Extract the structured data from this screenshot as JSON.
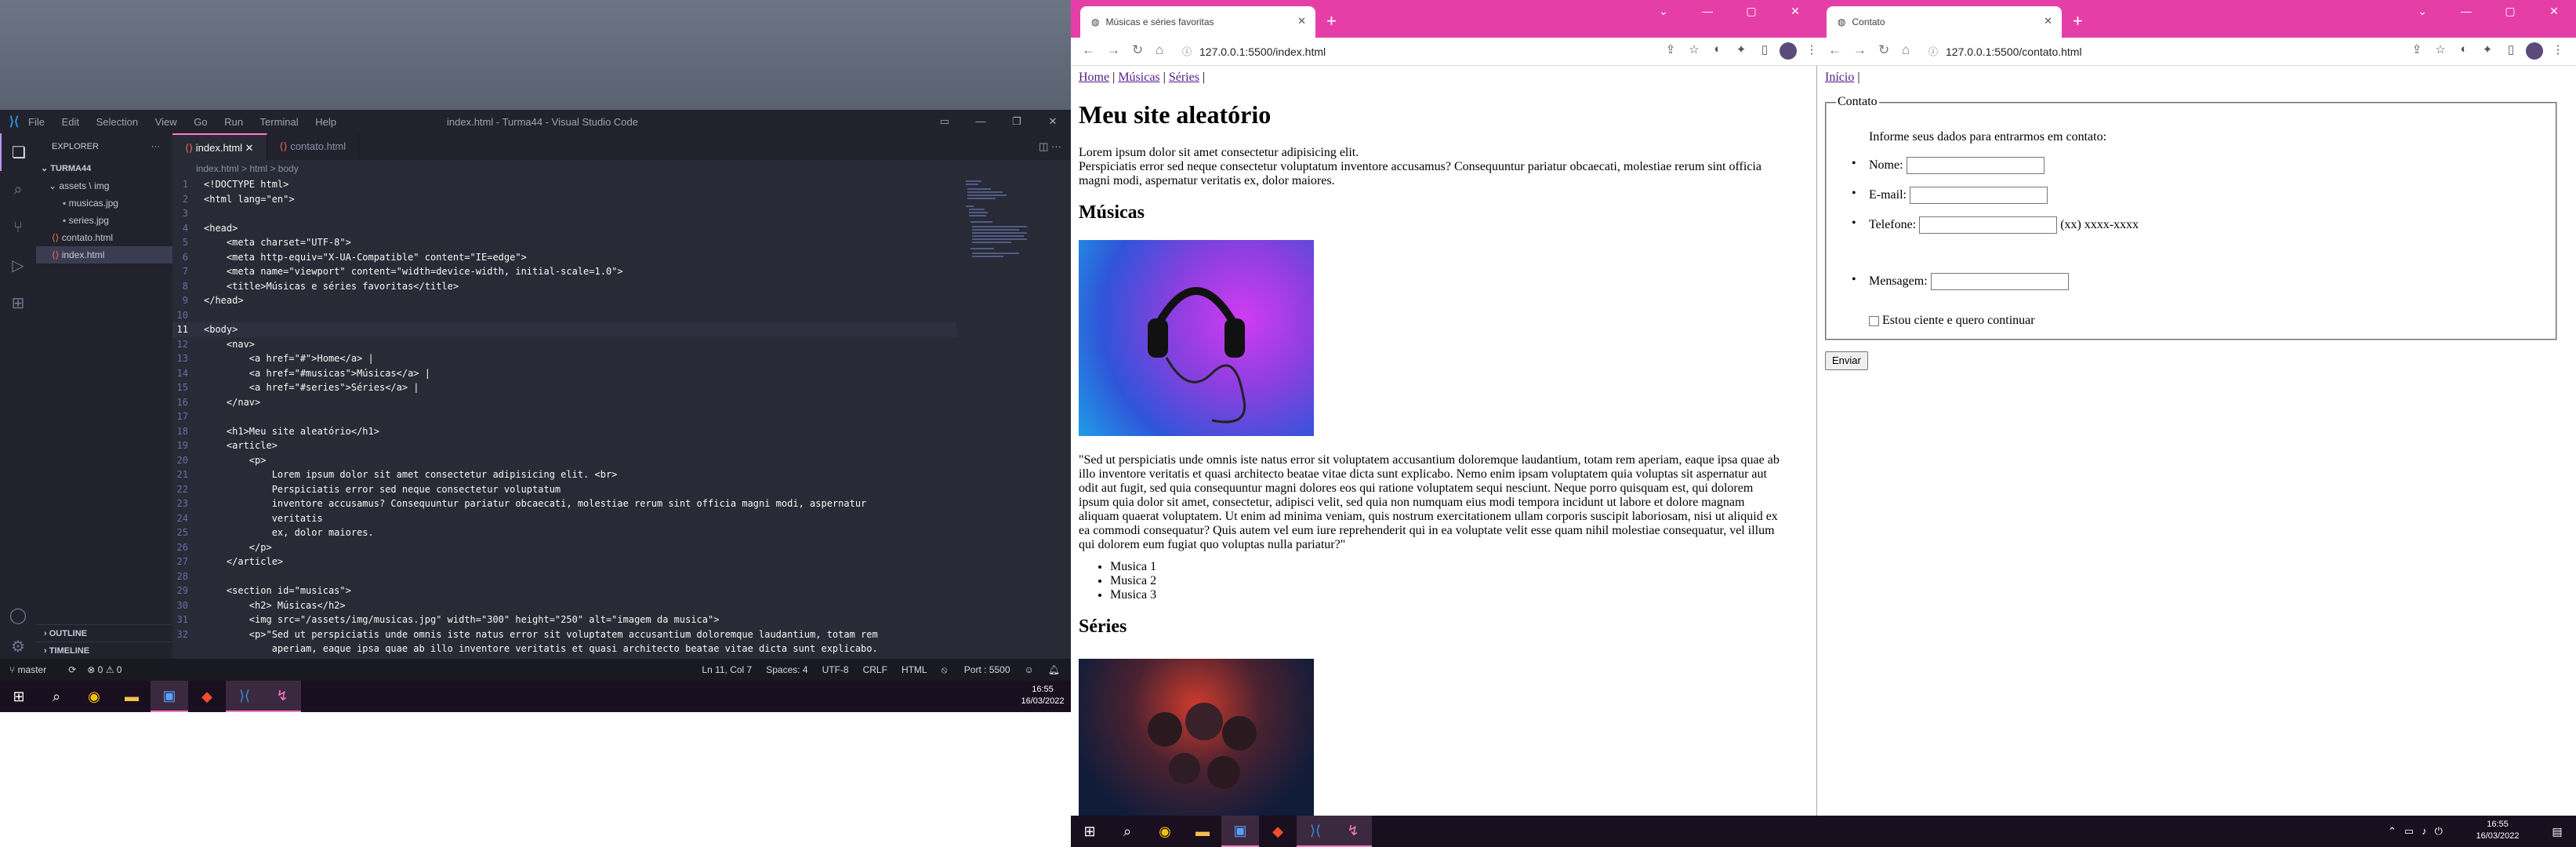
{
  "vscode": {
    "title": "index.html - Turma44 - Visual Studio Code",
    "menu": [
      "File",
      "Edit",
      "Selection",
      "View",
      "Go",
      "Run",
      "Terminal",
      "Help"
    ],
    "explorer_header": "EXPLORER",
    "folder": "TURMA44",
    "tree": [
      "assets \\ img",
      "musicas.jpg",
      "series.jpg",
      "contato.html",
      "index.html"
    ],
    "outline": "OUTLINE",
    "timeline": "TIMELINE",
    "tabs": [
      "index.html",
      "contato.html"
    ],
    "breadcrumb": "index.html > html > body",
    "code": [
      {
        "n": "1",
        "t": "<!DOCTYPE html>"
      },
      {
        "n": "2",
        "t": "<html lang=\"en\">"
      },
      {
        "n": "3",
        "t": ""
      },
      {
        "n": "4",
        "t": "<head>"
      },
      {
        "n": "5",
        "t": "    <meta charset=\"UTF-8\">"
      },
      {
        "n": "6",
        "t": "    <meta http-equiv=\"X-UA-Compatible\" content=\"IE=edge\">"
      },
      {
        "n": "7",
        "t": "    <meta name=\"viewport\" content=\"width=device-width, initial-scale=1.0\">"
      },
      {
        "n": "8",
        "t": "    <title>Músicas e séries favoritas</title>"
      },
      {
        "n": "9",
        "t": "</head>"
      },
      {
        "n": "10",
        "t": ""
      },
      {
        "n": "11",
        "t": "<body>"
      },
      {
        "n": "12",
        "t": "    <nav>"
      },
      {
        "n": "13",
        "t": "        <a href=\"#\">Home</a> |"
      },
      {
        "n": "14",
        "t": "        <a href=\"#musicas\">Músicas</a> |"
      },
      {
        "n": "15",
        "t": "        <a href=\"#series\">Séries</a> |"
      },
      {
        "n": "16",
        "t": "    </nav>"
      },
      {
        "n": "17",
        "t": ""
      },
      {
        "n": "18",
        "t": "    <h1>Meu site aleatório</h1>"
      },
      {
        "n": "19",
        "t": "    <article>"
      },
      {
        "n": "20",
        "t": "        <p>"
      },
      {
        "n": "21",
        "t": "            Lorem ipsum dolor sit amet consectetur adipisicing elit. <br>"
      },
      {
        "n": "22",
        "t": "            Perspiciatis error sed neque consectetur voluptatum"
      },
      {
        "n": "23",
        "t": "            inventore accusamus? Consequuntur pariatur obcaecati, molestiae rerum sint officia magni modi, aspernatur"
      },
      {
        "n": "24",
        "t": "            veritatis"
      },
      {
        "n": "25",
        "t": "            ex, dolor maiores."
      },
      {
        "n": "26",
        "t": "        </p>"
      },
      {
        "n": "27",
        "t": "    </article>"
      },
      {
        "n": "28",
        "t": ""
      },
      {
        "n": "29",
        "t": "    <section id=\"musicas\">"
      },
      {
        "n": "30",
        "t": "        <h2> Músicas</h2>"
      },
      {
        "n": "31",
        "t": "        <img src=\"/assets/img/musicas.jpg\" width=\"300\" height=\"250\" alt=\"imagem da musica\">"
      },
      {
        "n": "32",
        "t": "        <p>\"Sed ut perspiciatis unde omnis iste natus error sit voluptatem accusantium doloremque laudantium, totam rem"
      },
      {
        "n": "",
        "t": "            aperiam, eaque ipsa quae ab illo inventore veritatis et quasi architecto beatae vitae dicta sunt explicabo."
      }
    ],
    "status": {
      "branch": "master",
      "problems": "⊗ 0 ⚠ 0",
      "position": "Ln 11, Col 7",
      "spaces": "Spaces: 4",
      "encoding": "UTF-8",
      "eol": "CRLF",
      "language": "HTML",
      "port": "Port : 5500"
    }
  },
  "taskbar_left": {
    "time": "16:55",
    "date": "16/03/2022"
  },
  "taskbar_right": {
    "time": "16:55",
    "date": "16/03/2022"
  },
  "browser1": {
    "tab_title": "Músicas e séries favoritas",
    "url": "127.0.0.1:5500/index.html",
    "nav_links": [
      "Home",
      "Músicas",
      "Séries"
    ],
    "nav_sep": "|",
    "h1": "Meu site aleatório",
    "lorem_line1": "Lorem ipsum dolor sit amet consectetur adipisicing elit.",
    "lorem_line2": "Perspiciatis error sed neque consectetur voluptatum inventore accusamus? Consequuntur pariatur obcaecati, molestiae rerum sint officia magni modi, aspernatur veritatis ex, dolor maiores.",
    "h2_musicas": "Músicas",
    "quote": "\"Sed ut perspiciatis unde omnis iste natus error sit voluptatem accusantium doloremque laudantium, totam rem aperiam, eaque ipsa quae ab illo inventore veritatis et quasi architecto beatae vitae dicta sunt explicabo. Nemo enim ipsam voluptatem quia voluptas sit aspernatur aut odit aut fugit, sed quia consequuntur magni dolores eos qui ratione voluptatem sequi nesciunt. Neque porro quisquam est, qui dolorem ipsum quia dolor sit amet, consectetur, adipisci velit, sed quia non numquam eius modi tempora incidunt ut labore et dolore magnam aliquam quaerat voluptatem. Ut enim ad minima veniam, quis nostrum exercitationem ullam corporis suscipit laboriosam, nisi ut aliquid ex ea commodi consequatur? Quis autem vel eum iure reprehenderit qui in ea voluptate velit esse quam nihil molestiae consequatur, vel illum qui dolorem eum fugiat quo voluptas nulla pariatur?\"",
    "list": [
      "Musica 1",
      "Musica 2",
      "Musica 3"
    ],
    "h2_series": "Séries"
  },
  "browser2": {
    "tab_title": "Contato",
    "url": "127.0.0.1:5500/contato.html",
    "inicio": "Início",
    "legend": "Contato",
    "intro": "Informe seus dados para entrarmos em contato:",
    "nome": "Nome:",
    "email": "E-mail:",
    "telefone": "Telefone:",
    "telefone_hint": "(xx) xxxx-xxxx",
    "mensagem": "Mensagem:",
    "checkbox": "Estou ciente e quero continuar",
    "enviar": "Enviar"
  }
}
